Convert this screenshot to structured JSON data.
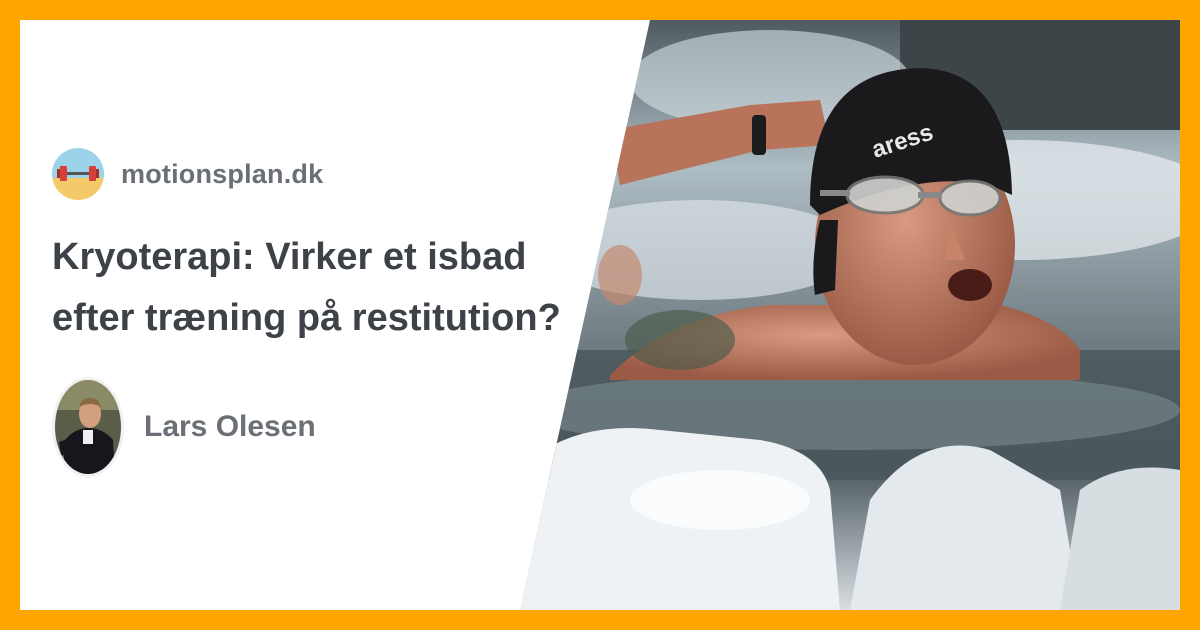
{
  "site": {
    "name": "motionsplan.dk",
    "logo_icon": "dumbbell-beach-icon"
  },
  "article": {
    "title_line1": "Kryoterapi: Virker et isbad",
    "title_line2": "efter træning på restitution?"
  },
  "author": {
    "name": "Lars Olesen",
    "avatar_icon": "person-portrait-icon"
  },
  "colors": {
    "border": "#FFA500",
    "text_dark": "#3d4148",
    "text_muted": "#6b6f76"
  },
  "cap_brand": "aress"
}
